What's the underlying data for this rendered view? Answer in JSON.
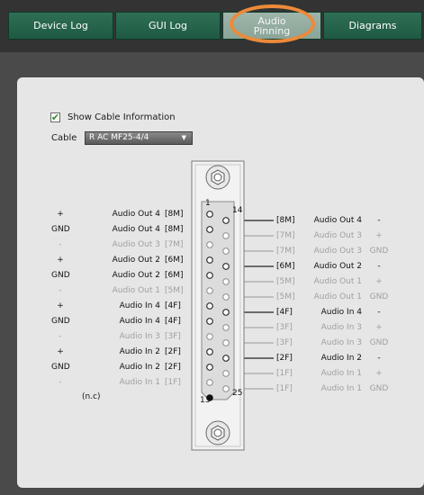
{
  "tabs": [
    {
      "label": "Device Log"
    },
    {
      "label": "GUI Log"
    },
    {
      "label": "Audio Pinning"
    },
    {
      "label": "Diagrams"
    }
  ],
  "options": {
    "show_cable_info_label": "Show Cable Information",
    "show_cable_info_checked": true,
    "cable_label": "Cable",
    "cable_value": "R AC MF25-4/4"
  },
  "connector": {
    "pin_labels": {
      "top_left": "1",
      "top_right": "14",
      "bottom_left": "13",
      "bottom_right": "25"
    },
    "left_rows": [
      {
        "sign": "+",
        "name": "Audio Out 4",
        "tag": "[8M]",
        "active": true
      },
      {
        "sign": "GND",
        "name": "Audio Out 4",
        "tag": "[8M]",
        "active": true
      },
      {
        "sign": "-",
        "name": "Audio Out 3",
        "tag": "[7M]",
        "active": false
      },
      {
        "sign": "+",
        "name": "Audio Out 2",
        "tag": "[6M]",
        "active": true
      },
      {
        "sign": "GND",
        "name": "Audio Out 2",
        "tag": "[6M]",
        "active": true
      },
      {
        "sign": "-",
        "name": "Audio Out 1",
        "tag": "[5M]",
        "active": false
      },
      {
        "sign": "+",
        "name": "Audio In 4",
        "tag": "[4F]",
        "active": true
      },
      {
        "sign": "GND",
        "name": "Audio In 4",
        "tag": "[4F]",
        "active": true
      },
      {
        "sign": "-",
        "name": "Audio In 3",
        "tag": "[3F]",
        "active": false
      },
      {
        "sign": "+",
        "name": "Audio In 2",
        "tag": "[2F]",
        "active": true
      },
      {
        "sign": "GND",
        "name": "Audio In 2",
        "tag": "[2F]",
        "active": true
      },
      {
        "sign": "-",
        "name": "Audio In 1",
        "tag": "[1F]",
        "active": false
      }
    ],
    "right_rows": [
      {
        "tag": "[8M]",
        "name": "Audio Out 4",
        "sign": "-",
        "active": true
      },
      {
        "tag": "[7M]",
        "name": "Audio Out 3",
        "sign": "+",
        "active": false
      },
      {
        "tag": "[7M]",
        "name": "Audio Out 3",
        "sign": "GND",
        "active": false
      },
      {
        "tag": "[6M]",
        "name": "Audio Out 2",
        "sign": "-",
        "active": true
      },
      {
        "tag": "[5M]",
        "name": "Audio Out 1",
        "sign": "+",
        "active": false
      },
      {
        "tag": "[5M]",
        "name": "Audio Out 1",
        "sign": "GND",
        "active": false
      },
      {
        "tag": "[4F]",
        "name": "Audio In 4",
        "sign": "-",
        "active": true
      },
      {
        "tag": "[3F]",
        "name": "Audio In 3",
        "sign": "+",
        "active": false
      },
      {
        "tag": "[3F]",
        "name": "Audio In 3",
        "sign": "GND",
        "active": false
      },
      {
        "tag": "[2F]",
        "name": "Audio In 2",
        "sign": "-",
        "active": true
      },
      {
        "tag": "[1F]",
        "name": "Audio In 1",
        "sign": "+",
        "active": false
      },
      {
        "tag": "[1F]",
        "name": "Audio In 1",
        "sign": "GND",
        "active": false
      }
    ],
    "unconnected_label": "(n.c)"
  },
  "colors": {
    "tab_green": "#2e6f55",
    "tab_active": "#9fb5aa",
    "highlight_ring": "#ec8a3a",
    "wire_active": "#222222",
    "wire_inactive": "#a8a8a8"
  }
}
